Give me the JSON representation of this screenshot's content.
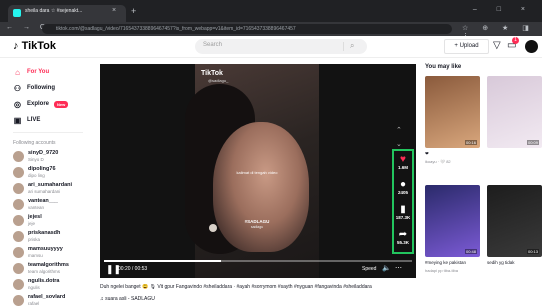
{
  "browser": {
    "tab_title": "sheila dara ☆ #sejenakt...",
    "tab_close": "×",
    "new_tab": "+",
    "window_controls": "– □ ×",
    "nav_buttons": "← → C",
    "url": "tiktok.com/@sadlagu_/video/7165437338896467457?is_from_webapp=v1&item_id=7165437338896467457",
    "extensions": "☆ ⊕ ★ ◨ ⋮"
  },
  "header": {
    "logo": "TikTok",
    "search_placeholder": "Search",
    "upload_label": "+ Upload",
    "inbox_badge": "1"
  },
  "sidebar": {
    "nav": [
      {
        "label": "For You",
        "icon": "home-icon"
      },
      {
        "label": "Following",
        "icon": "following-icon"
      },
      {
        "label": "Explore",
        "icon": "compass-icon",
        "badge": "New"
      },
      {
        "label": "LIVE",
        "icon": "live-icon"
      }
    ],
    "following_heading": "Following accounts",
    "accounts": [
      {
        "name": "sinyD_9720",
        "sub": "Sinyo D"
      },
      {
        "name": "dipoling76",
        "sub": "dipo ling"
      },
      {
        "name": "ari_sumahardani",
        "sub": "ari sumahardani"
      },
      {
        "name": "vantean___",
        "sub": "vantean"
      },
      {
        "name": "jejesl",
        "sub": "jeje"
      },
      {
        "name": "priskanasdh",
        "sub": "priska"
      },
      {
        "name": "mamsuuyyyy",
        "sub": "mamsu"
      },
      {
        "name": "teamalgorithms",
        "sub": "team algorithms"
      },
      {
        "name": "ngulis.dotra",
        "sub": "ngulis"
      },
      {
        "name": "rafael_sovlard",
        "sub": "rafael"
      }
    ]
  },
  "player": {
    "watermark": "TikTok",
    "watermark_handle": "@sadlagu_",
    "caption_top": "kalimat di tengah video",
    "caption_handle": "#SADLAGU",
    "caption_sub": "sadlagu",
    "actions": [
      {
        "icon": "heart-icon",
        "glyph": "♥",
        "count": "1.6M",
        "color": "#fe2c55"
      },
      {
        "icon": "comment-icon",
        "glyph": "●",
        "count": "2405",
        "color": "#ffffff"
      },
      {
        "icon": "bookmark-icon",
        "glyph": "▮",
        "count": "187.3K",
        "color": "#ffffff"
      },
      {
        "icon": "share-icon",
        "glyph": "➦",
        "count": "55.3K",
        "color": "#ffffff"
      }
    ],
    "time": "00:20 / 00:53",
    "progress": 0.38,
    "speed_label": "Speed"
  },
  "description": {
    "text": "Duh ngelei banget 😩 🎙 Vit gpur Fangavindo #sheiladdara · #ayah #sorrymom #sayth #nyguan #fangavinda #sheiladdara",
    "music": "♫ suara asli - SADLAGU"
  },
  "may_like": {
    "heading": "You may like",
    "items": [
      {
        "title": "❤",
        "sub": "ikoayu · 🤍 82",
        "duration": "00:16",
        "color_a": "#8a5a3c",
        "color_b": "#d9a77d"
      },
      {
        "title": "",
        "sub": "",
        "duration": "00:09",
        "color_a": "#d8c9d9",
        "color_b": "#f2eaf2"
      },
      {
        "title": "#meying ke pakistan",
        "sub": "hadapi pp tiba-tiba",
        "duration": "00:48",
        "color_a": "#2a2a6a",
        "color_b": "#7c5bd6"
      },
      {
        "title": "sedih yg tidak",
        "sub": "",
        "duration": "00:13",
        "color_a": "#1d1d1d",
        "color_b": "#3a3a3a"
      }
    ]
  }
}
